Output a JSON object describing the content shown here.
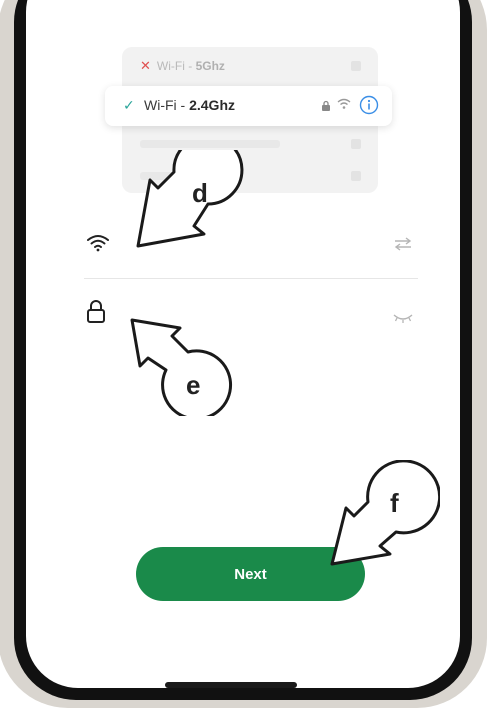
{
  "wifi_picker": {
    "row_5g": {
      "prefix": "Wi-Fi - ",
      "band": "5Ghz",
      "status_icon": "x-icon"
    },
    "row_24g": {
      "prefix": "Wi-Fi - ",
      "band": "2.4Ghz",
      "status_icon": "check-icon"
    }
  },
  "callouts": {
    "d": "d",
    "e": "e",
    "f": "f"
  },
  "next_button": {
    "label": "Next"
  },
  "colors": {
    "accent_green": "#1a8a4a",
    "info_blue": "#3a8ee6",
    "check_teal": "#2aa59a",
    "error_red": "#e05050"
  }
}
